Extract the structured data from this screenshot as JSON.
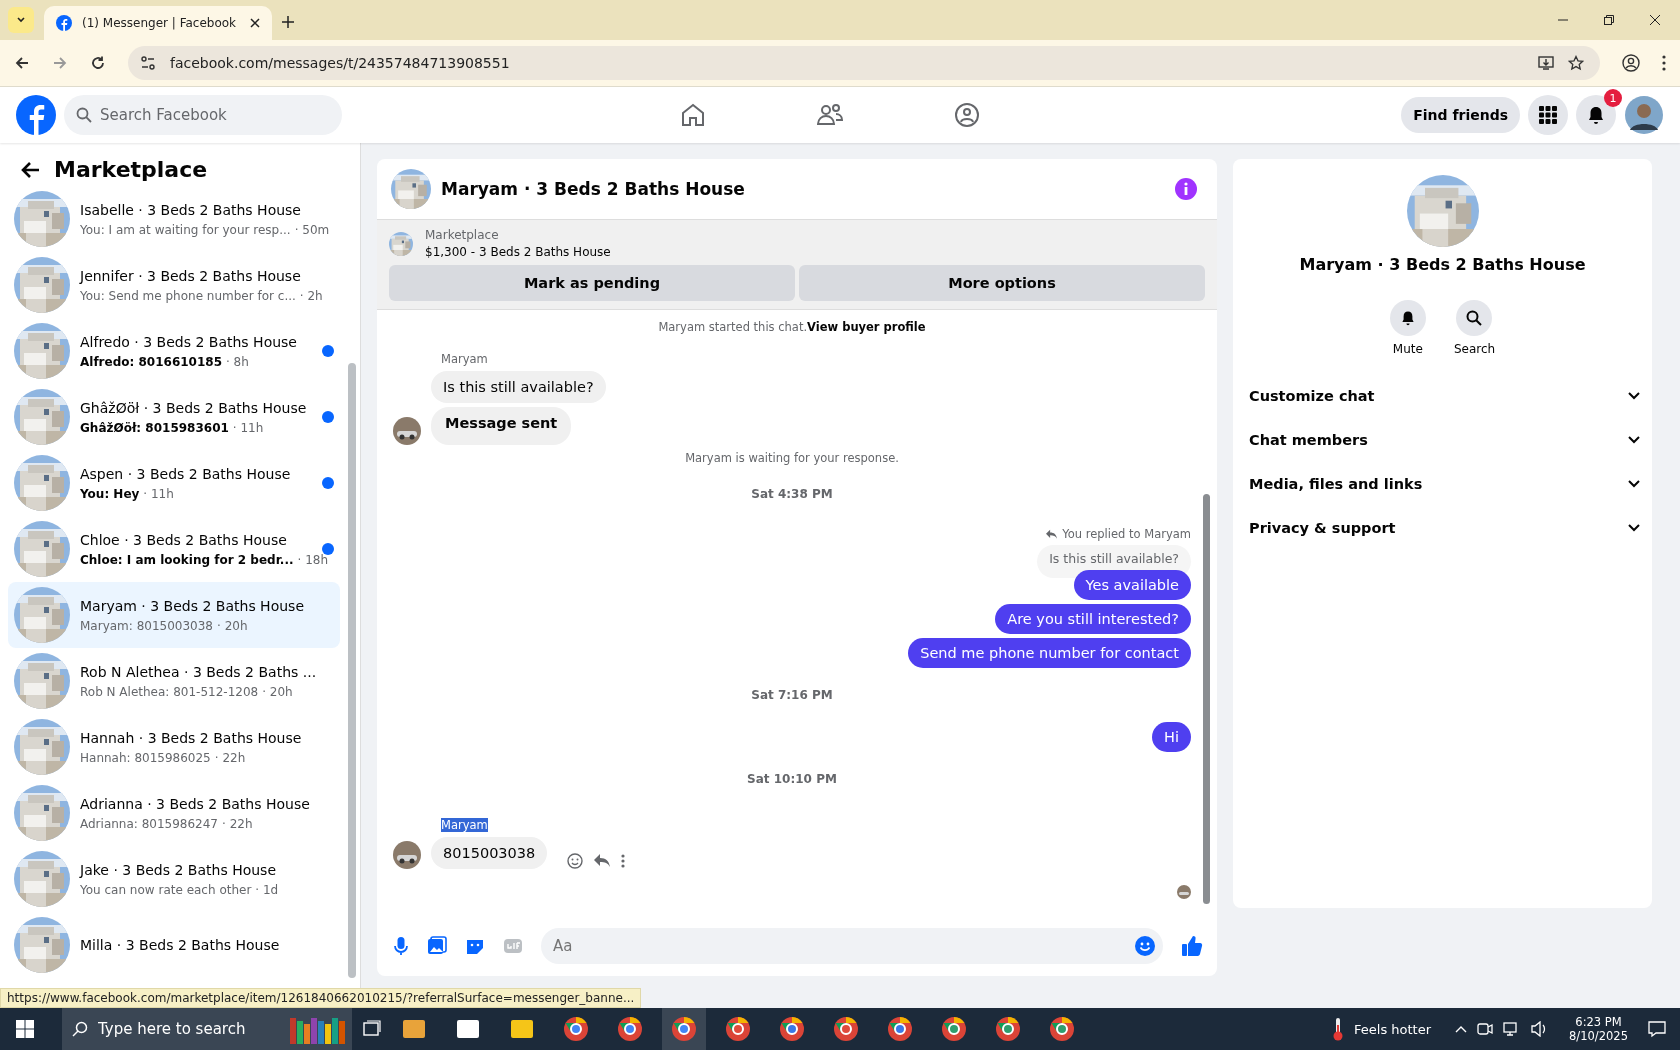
{
  "browser": {
    "tab_title": "(1) Messenger | Facebook",
    "url": "facebook.com/messages/t/24357484713908551",
    "status_url": "https://www.facebook.com/marketplace/item/1261840662010215/?referralSurface=messenger_banne..."
  },
  "header": {
    "search_placeholder": "Search Facebook",
    "find_friends": "Find friends",
    "notification_count": "1"
  },
  "sidebar": {
    "title": "Marketplace",
    "conversations": [
      {
        "title": "Isabelle · 3 Beds 2 Baths House",
        "preview": "You: I am at waiting for your resp...",
        "time": "· 50m",
        "unread": false,
        "selected": false
      },
      {
        "title": "Jennifer · 3 Beds 2 Baths House",
        "preview": "You: Send me phone number for c...",
        "time": "· 2h",
        "unread": false,
        "selected": false
      },
      {
        "title": "Alfredo · 3 Beds 2 Baths House",
        "preview": "Alfredo: 8016610185",
        "time": "· 8h",
        "unread": true,
        "selected": false
      },
      {
        "title": "GhâžØöł · 3 Beds 2 Baths House",
        "preview": "GhâžØöł: 8015983601",
        "time": "· 11h",
        "unread": true,
        "selected": false
      },
      {
        "title": "Aspen · 3 Beds 2 Baths House",
        "preview": "You: Hey",
        "time": "· 11h",
        "unread": true,
        "selected": false
      },
      {
        "title": "Chloe · 3 Beds 2 Baths House",
        "preview": "Chloe: I am looking for 2 bedr...",
        "time": "· 18h",
        "unread": true,
        "selected": false
      },
      {
        "title": "Maryam · 3 Beds 2 Baths House",
        "preview": "Maryam: 8015003038",
        "time": "· 20h",
        "unread": false,
        "selected": true
      },
      {
        "title": "Rob N Alethea · 3 Beds 2 Baths ...",
        "preview": "Rob N Alethea: 801-512-1208",
        "time": "· 20h",
        "unread": false,
        "selected": false
      },
      {
        "title": "Hannah · 3 Beds 2 Baths House",
        "preview": "Hannah: 8015986025",
        "time": "· 22h",
        "unread": false,
        "selected": false
      },
      {
        "title": "Adrianna · 3 Beds 2 Baths House",
        "preview": "Adrianna: 8015986247",
        "time": "· 22h",
        "unread": false,
        "selected": false
      },
      {
        "title": "Jake · 3 Beds 2 Baths House",
        "preview": "You can now rate each other",
        "time": "· 1d",
        "unread": false,
        "selected": false
      },
      {
        "title": "Milla · 3 Beds 2 Baths House",
        "unread": false,
        "selected": false
      }
    ]
  },
  "chat": {
    "title": "Maryam · 3 Beds 2 Baths House",
    "listing": {
      "label": "Marketplace",
      "name": "$1,300 - 3 Beds 2 Baths House"
    },
    "buttons": [
      "Mark as pending",
      "More options"
    ],
    "messages": [
      {
        "kind": "system",
        "text": "Maryam started this chat.",
        "link": "View buyer profile"
      },
      {
        "kind": "sender",
        "text": "Maryam",
        "highlighted": false
      },
      {
        "kind": "incoming",
        "text": "Is this still available?",
        "emphasis": false,
        "avatar": false,
        "actions": false
      },
      {
        "kind": "incoming",
        "text": "Message sent",
        "emphasis": true,
        "avatar": true,
        "actions": false
      },
      {
        "kind": "system",
        "text": "Maryam is waiting for your response."
      },
      {
        "kind": "timestamp",
        "text": "Sat 4:38 PM"
      },
      {
        "kind": "reply_header",
        "text": "You replied to Maryam"
      },
      {
        "kind": "quoted",
        "text": "Is this still available?"
      },
      {
        "kind": "outgoing",
        "text": "Yes available"
      },
      {
        "kind": "outgoing",
        "text": "Are you still interested?"
      },
      {
        "kind": "outgoing",
        "text": "Send me phone number for contact"
      },
      {
        "kind": "timestamp",
        "text": "Sat 7:16 PM"
      },
      {
        "kind": "outgoing",
        "text": "Hi"
      },
      {
        "kind": "timestamp",
        "text": "Sat 10:10 PM"
      },
      {
        "kind": "sender",
        "text": "Maryam",
        "highlighted": true
      },
      {
        "kind": "incoming",
        "text": "8015003038",
        "emphasis": false,
        "avatar": true,
        "actions": true
      }
    ],
    "composer_placeholder": "Aa"
  },
  "info": {
    "name": "Maryam · 3 Beds 2 Baths House",
    "actions": [
      {
        "kind": "mute",
        "label": "Mute"
      },
      {
        "kind": "search",
        "label": "Search"
      }
    ],
    "sections": [
      "Customize chat",
      "Chat members",
      "Media, files and links",
      "Privacy & support"
    ]
  },
  "taskbar": {
    "search_placeholder": "Type here to search",
    "weather": "Feels hotter",
    "time": "6:23 PM",
    "date": "8/10/2025"
  }
}
